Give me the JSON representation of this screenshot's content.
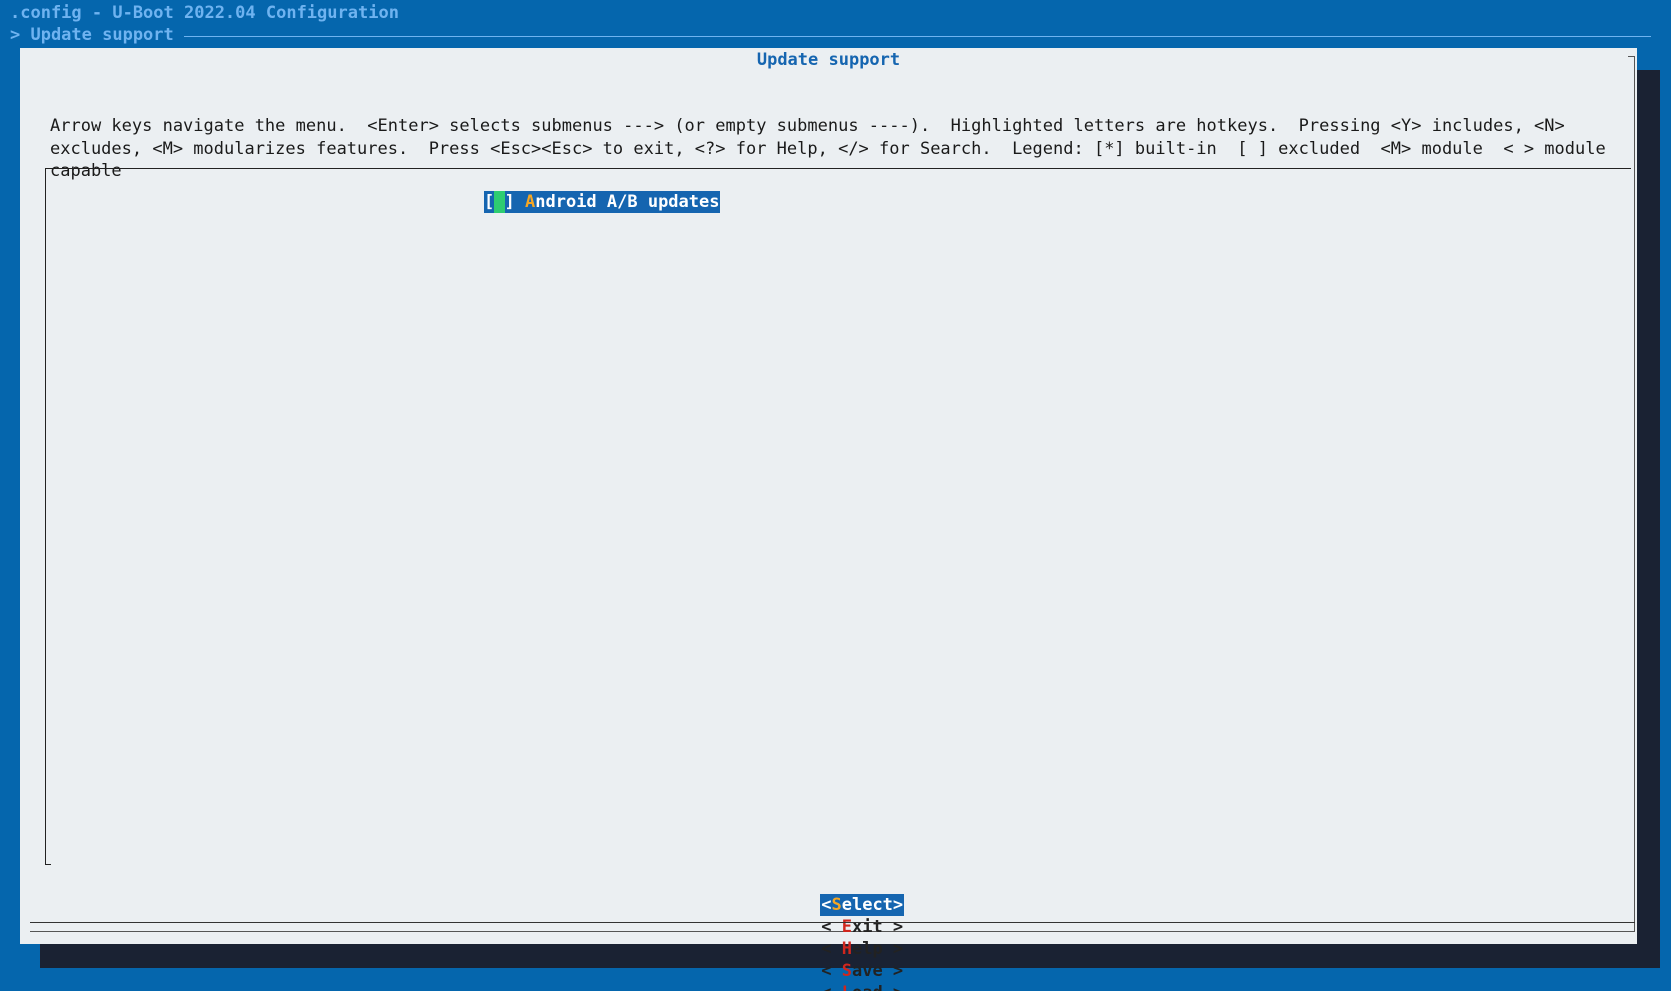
{
  "window": {
    "title": ".config - U-Boot 2022.04 Configuration",
    "breadcrumb": "> Update support"
  },
  "dialog": {
    "title": "Update support",
    "help_text": "Arrow keys navigate the menu.  <Enter> selects submenus ---> (or empty submenus ----).  Highlighted letters are hotkeys.  Pressing <Y> includes, <N>\nexcludes, <M> modularizes features.  Press <Esc><Esc> to exit, <?> for Help, </> for Search.  Legend: [*] built-in  [ ] excluded  <M> module  < > module\ncapable"
  },
  "menu": {
    "items": [
      {
        "checkbox_open": "[",
        "checkbox_state": " ",
        "checkbox_close": "]",
        "hotkey": "A",
        "label_rest": "ndroid A/B updates",
        "selected": true
      }
    ]
  },
  "buttons": {
    "select": {
      "prefix": "<",
      "hotkey": "S",
      "rest": "elect",
      "suffix": ">"
    },
    "exit": {
      "prefix": "< ",
      "hotkey": "E",
      "rest": "xit",
      "suffix": " >"
    },
    "help": {
      "prefix": "< ",
      "hotkey": "H",
      "rest": "elp",
      "suffix": " >"
    },
    "save": {
      "prefix": "< ",
      "hotkey": "S",
      "rest": "ave",
      "suffix": " >"
    },
    "load": {
      "prefix": "< ",
      "hotkey": "L",
      "rest": "oad",
      "suffix": " >"
    }
  },
  "colors": {
    "background": "#0566ad",
    "dialog": "#ebeff2",
    "title_text": "#1565b0",
    "selection_bg": "#1565b0",
    "hotkey_selected": "#f5a623",
    "hotkey": "#d0261d",
    "cursor": "#2ecc71"
  }
}
